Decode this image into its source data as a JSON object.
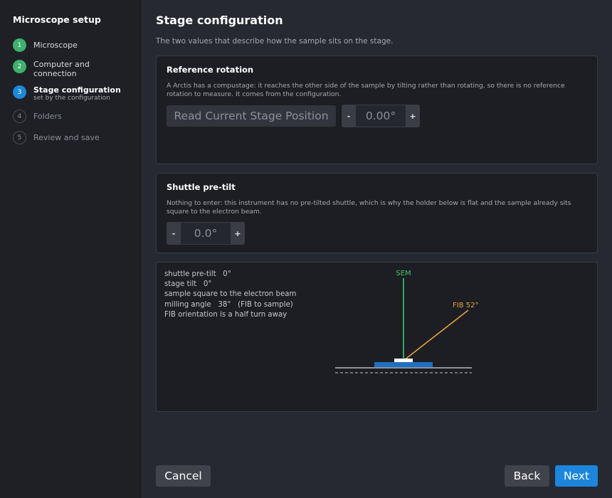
{
  "sidebar": {
    "title": "Microscope setup",
    "steps": [
      {
        "number": "1",
        "label": "Microscope",
        "status": "done"
      },
      {
        "number": "2",
        "label": "Computer and connection",
        "status": "done"
      },
      {
        "number": "3",
        "label": "Stage configuration",
        "sublabel": "set by the configuration",
        "status": "active"
      },
      {
        "number": "4",
        "label": "Folders",
        "status": "todo"
      },
      {
        "number": "5",
        "label": "Review and save",
        "status": "todo"
      }
    ]
  },
  "main": {
    "title": "Stage configuration",
    "description": "The two values that describe how the sample sits on the stage.",
    "reference_rotation": {
      "title": "Reference rotation",
      "description": "A Arctis has a compustage: it reaches the other side of the sample by tilting rather than rotating, so there is no reference rotation to measure. It comes from the configuration.",
      "read_button_label": "Read Current Stage Position",
      "decrement_label": "-",
      "increment_label": "+",
      "value": "0.00°"
    },
    "shuttle_pretilt": {
      "title": "Shuttle pre-tilt",
      "description": "Nothing to enter: this instrument has no pre-tilted shuttle, which is why the holder below is flat and the sample already sits square to the electron beam.",
      "decrement_label": "-",
      "increment_label": "+",
      "value": "0.0°"
    },
    "diagram": {
      "readout": [
        "shuttle pre-tilt   0°",
        "stage tilt   0°",
        "sample square to the electron beam",
        "milling angle   38°   (FIB to sample)",
        "FIB orientation is a half turn away"
      ],
      "sem_label": "SEM",
      "fib_label": "FIB  52°",
      "fib_angle_deg": 52,
      "colors": {
        "sem": "#3fc46a",
        "fib": "#e9a23b",
        "holder": "#1f6fc2",
        "sample": "#ffffff",
        "stage": "#9ea2a8"
      }
    }
  },
  "footer": {
    "cancel_label": "Cancel",
    "back_label": "Back",
    "next_label": "Next"
  }
}
